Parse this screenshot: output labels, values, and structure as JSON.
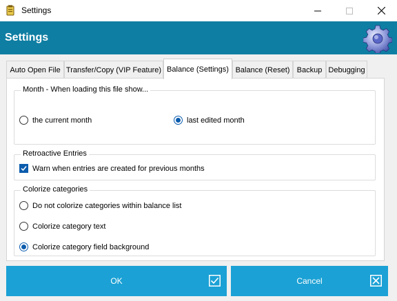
{
  "window": {
    "title": "Settings",
    "app_icon": "app-icon",
    "minimize_icon": "minimize-icon",
    "maximize_icon": "maximize-icon",
    "close_icon": "close-icon"
  },
  "header": {
    "title": "Settings",
    "icon": "gear-icon",
    "color": "#0f7ea3"
  },
  "tabs": [
    {
      "label": "Auto Open File",
      "active": false
    },
    {
      "label": "Transfer/Copy (VIP Feature)",
      "active": false
    },
    {
      "label": "Balance (Settings)",
      "active": true
    },
    {
      "label": "Balance (Reset)",
      "active": false
    },
    {
      "label": "Backup",
      "active": false
    },
    {
      "label": "Debugging",
      "active": false
    }
  ],
  "month_group": {
    "title": "Month - When loading this file show...",
    "options": [
      {
        "label": "the current month",
        "checked": false
      },
      {
        "label": "last edited month",
        "checked": true
      }
    ]
  },
  "retro_group": {
    "title": "Retroactive Entries",
    "checkbox": {
      "label": "Warn when entries are created for previous months",
      "checked": true
    }
  },
  "colorize_group": {
    "title": "Colorize categories",
    "options": [
      {
        "label": "Do not colorize categories within balance list",
        "checked": false
      },
      {
        "label": "Colorize category text",
        "checked": false
      },
      {
        "label": "Colorize category field background",
        "checked": true
      }
    ]
  },
  "buttons": {
    "ok_label": "OK",
    "cancel_label": "Cancel",
    "ok_icon": "check-box-icon",
    "cancel_icon": "x-box-icon",
    "color": "#1ba1d5"
  }
}
